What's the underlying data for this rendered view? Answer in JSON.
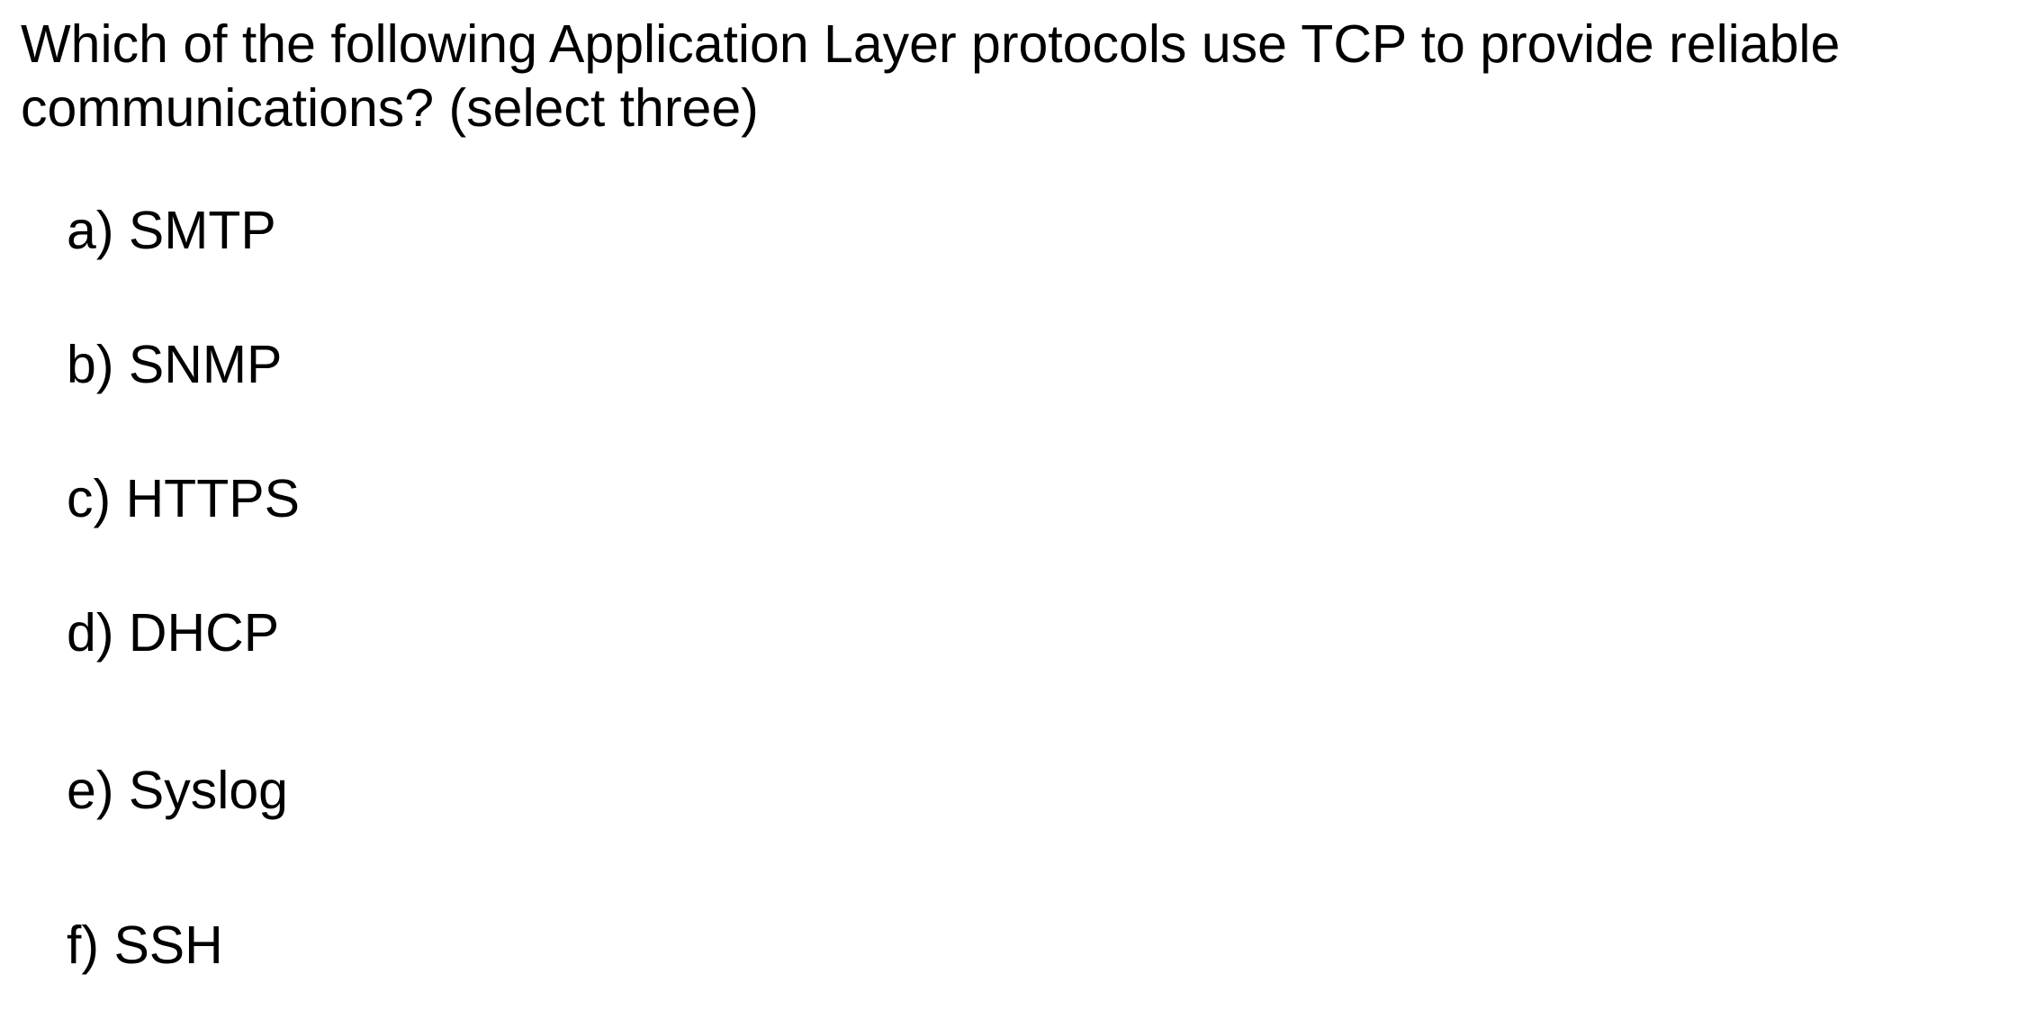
{
  "question": {
    "text": "Which of the following Application Layer protocols use TCP to provide reliable communications? (select three)"
  },
  "options": [
    {
      "letter": "a)",
      "label": "SMTP"
    },
    {
      "letter": "b)",
      "label": "SNMP"
    },
    {
      "letter": "c)",
      "label": "HTTPS"
    },
    {
      "letter": "d)",
      "label": "DHCP"
    },
    {
      "letter": "e)",
      "label": "Syslog"
    },
    {
      "letter": "f)",
      "label": "SSH"
    }
  ]
}
